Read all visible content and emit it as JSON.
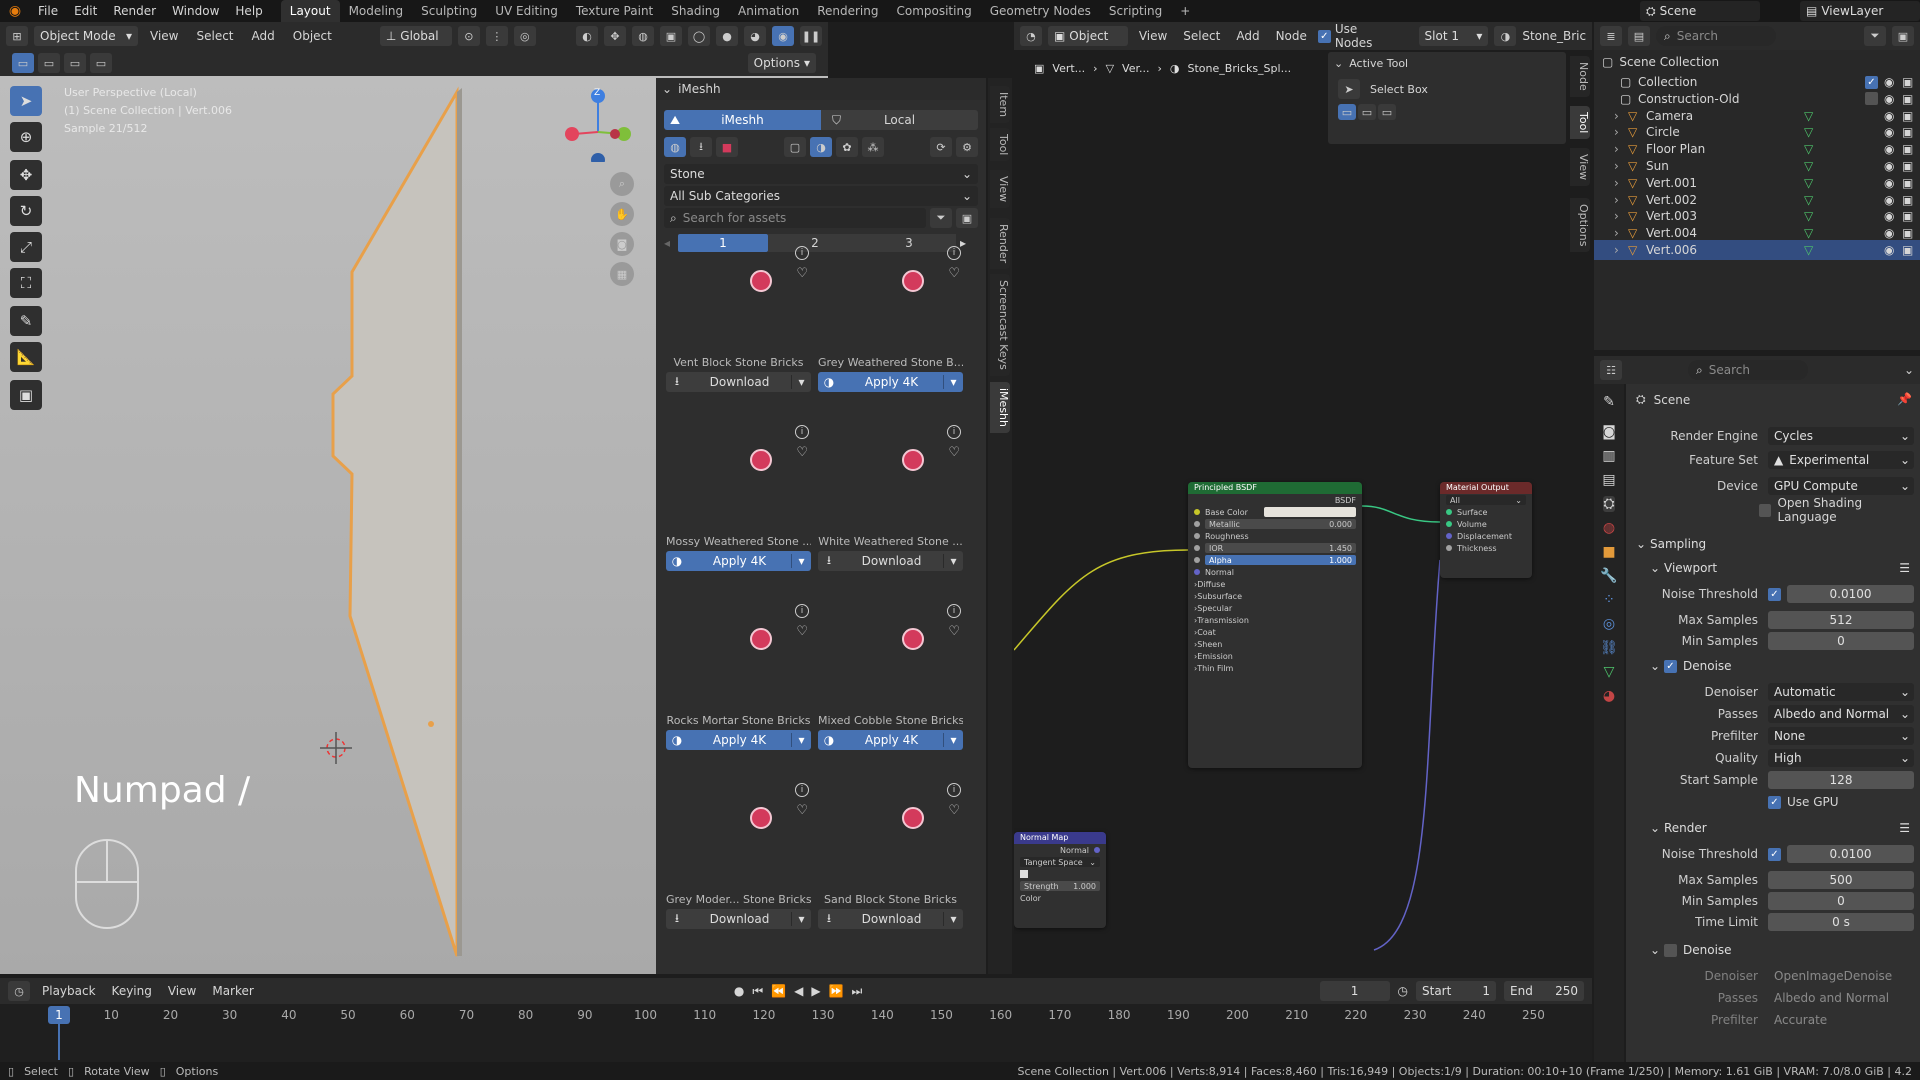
{
  "topbar": {
    "menus": [
      "File",
      "Edit",
      "Render",
      "Window",
      "Help"
    ],
    "workspaces": [
      "Layout",
      "Modeling",
      "Sculpting",
      "UV Editing",
      "Texture Paint",
      "Shading",
      "Animation",
      "Rendering",
      "Compositing",
      "Geometry Nodes",
      "Scripting"
    ],
    "active_workspace": "Layout",
    "scene_label": "Scene",
    "view_layer_label": "ViewLayer"
  },
  "viewport": {
    "mode": "Object Mode",
    "menus": [
      "View",
      "Select",
      "Add",
      "Object"
    ],
    "transform": "Global",
    "options": "Options",
    "overlay_line1": "User Perspective (Local)",
    "overlay_line2": "(1) Scene Collection | Vert.006",
    "overlay_line3": "Sample 21/512",
    "numpad_label": "Numpad /",
    "gizmo_z": "Z"
  },
  "imeshh": {
    "title": "iMeshh",
    "tab_imeshh": "iMeshh",
    "tab_local": "Local",
    "category": "Stone",
    "subcategory": "All Sub Categories",
    "search_placeholder": "Search for assets",
    "pages": [
      "1",
      "2",
      "3"
    ],
    "assets": [
      {
        "name": "Vent Block Stone Bricks",
        "action": "Download",
        "applied": false,
        "color": "#d9d3b4"
      },
      {
        "name": "Grey Weathered Stone B...",
        "action": "Apply 4K",
        "applied": true,
        "color": "#8d8d8d"
      },
      {
        "name": "Mossy Weathered Stone ...",
        "action": "Apply 4K",
        "applied": true,
        "color": "#6f735c"
      },
      {
        "name": "White Weathered Stone ...",
        "action": "Download",
        "applied": false,
        "color": "#cfd0d0"
      },
      {
        "name": "Rocks Mortar Stone Bricks",
        "action": "Apply 4K",
        "applied": true,
        "color": "#8a8c8f"
      },
      {
        "name": "Mixed Cobble Stone Bricks",
        "action": "Apply 4K",
        "applied": true,
        "color": "#7d7b78"
      },
      {
        "name": "Grey Moder... Stone Bricks",
        "action": "Download",
        "applied": false,
        "color": "#8e8d8b"
      },
      {
        "name": "Sand Block Stone Bricks",
        "action": "Download",
        "applied": false,
        "color": "#d8c8a4"
      }
    ]
  },
  "side_tabs": [
    "Item",
    "Tool",
    "View",
    "Render",
    "Screencast Keys",
    "iMeshh"
  ],
  "node_editor": {
    "editor_mode": "Object",
    "menus": [
      "View",
      "Select",
      "Add",
      "Node"
    ],
    "use_nodes": "Use Nodes",
    "slot": "Slot 1",
    "material": "Stone_Bric",
    "breadcrumb": [
      "Vert...",
      "Ver...",
      "Stone_Bricks_Spl..."
    ],
    "active_tool_title": "Active Tool",
    "active_tool": "Select Box",
    "side_tabs": [
      "Node",
      "Tool",
      "View",
      "Options"
    ],
    "bsdf": {
      "title": "Principled BSDF",
      "out": "BSDF",
      "rows": [
        "Base Color",
        "Metallic",
        "Roughness",
        "IOR",
        "Alpha",
        "Normal",
        "Diffuse",
        "Subsurface",
        "Specular",
        "Transmission",
        "Coat",
        "Sheen",
        "Emission",
        "Thin Film"
      ],
      "metallic": "0.000",
      "ior": "1.450",
      "alpha": "1.000"
    },
    "output": {
      "title": "Material Output",
      "target": "All",
      "rows": [
        "Surface",
        "Volume",
        "Displacement",
        "Thickness"
      ]
    },
    "normal_map": {
      "title": "Normal Map",
      "out": "Normal",
      "space": "Tangent Space",
      "strength_label": "Strength",
      "strength": "1.000",
      "color": "Color"
    }
  },
  "outliner": {
    "search_placeholder": "Search",
    "root": "Scene Collection",
    "items": [
      {
        "name": "Collection",
        "indent": 1,
        "selected": false
      },
      {
        "name": "Construction-Old",
        "indent": 1,
        "selected": false
      },
      {
        "name": "Camera",
        "indent": 2,
        "selected": false
      },
      {
        "name": "Circle",
        "indent": 2,
        "selected": false
      },
      {
        "name": "Floor Plan",
        "indent": 2,
        "selected": false
      },
      {
        "name": "Sun",
        "indent": 2,
        "selected": false
      },
      {
        "name": "Vert.001",
        "indent": 2,
        "selected": false
      },
      {
        "name": "Vert.002",
        "indent": 2,
        "selected": false
      },
      {
        "name": "Vert.003",
        "indent": 2,
        "selected": false
      },
      {
        "name": "Vert.004",
        "indent": 2,
        "selected": false
      },
      {
        "name": "Vert.006",
        "indent": 2,
        "selected": true
      }
    ]
  },
  "properties": {
    "search_placeholder": "Search",
    "scene": "Scene",
    "render_engine_label": "Render Engine",
    "render_engine": "Cycles",
    "feature_set_label": "Feature Set",
    "feature_set": "Experimental",
    "device_label": "Device",
    "device": "GPU Compute",
    "osl": "Open Shading Language",
    "sampling": "Sampling",
    "viewport": "Viewport",
    "noise_threshold_label": "Noise Threshold",
    "vp_noise_threshold": "0.0100",
    "max_samples_label": "Max Samples",
    "vp_max_samples": "512",
    "min_samples_label": "Min Samples",
    "vp_min_samples": "0",
    "denoise": "Denoise",
    "denoiser_label": "Denoiser",
    "denoiser": "Automatic",
    "passes_label": "Passes",
    "passes": "Albedo and Normal",
    "prefilter_label": "Prefilter",
    "prefilter": "None",
    "quality_label": "Quality",
    "quality": "High",
    "start_sample_label": "Start Sample",
    "start_sample": "128",
    "use_gpu": "Use GPU",
    "render": "Render",
    "r_noise_threshold": "0.0100",
    "r_max_samples": "500",
    "r_min_samples": "0",
    "time_limit_label": "Time Limit",
    "time_limit": "0 s",
    "r_denoiser": "OpenImageDenoise",
    "r_passes": "Albedo and Normal",
    "r_prefilter": "Accurate"
  },
  "timeline": {
    "menus": [
      "Playback",
      "Keying",
      "View",
      "Marker"
    ],
    "current_frame": "1",
    "start_label": "Start",
    "start": "1",
    "end_label": "End",
    "end": "250",
    "ticks": [
      "1",
      "10",
      "20",
      "30",
      "40",
      "50",
      "60",
      "70",
      "80",
      "90",
      "100",
      "110",
      "120",
      "130",
      "140",
      "150",
      "160",
      "170",
      "180",
      "190",
      "200",
      "210",
      "220",
      "230",
      "240",
      "250"
    ]
  },
  "statusbar": {
    "select": "Select",
    "rotate": "Rotate View",
    "options": "Options",
    "stats": "Scene Collection | Vert.006 | Verts:8,914 | Faces:8,460 | Tris:16,949 | Objects:1/9 | Duration: 00:10+10 (Frame 1/250) | Memory: 1.61 GiB | VRAM: 7.0/8.0 GiB | 4.2"
  }
}
